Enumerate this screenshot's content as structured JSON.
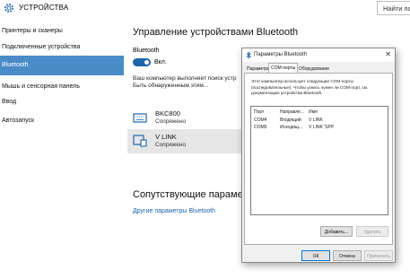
{
  "window": {
    "title": "УСТРОЙСТВА",
    "search_placeholder": "Найти пара"
  },
  "sidebar": {
    "items": [
      {
        "label": "Принтеры и сканеры",
        "selected": false
      },
      {
        "label": "Подключенные устройства",
        "selected": false
      },
      {
        "label": "Bluetooth",
        "selected": true
      },
      {
        "label": "Мышь и сенсорная панель",
        "selected": false
      },
      {
        "label": "Ввод",
        "selected": false
      },
      {
        "label": "Автозапуск",
        "selected": false
      }
    ]
  },
  "main": {
    "heading": "Управление устройствами Bluetooth",
    "bluetooth_label": "Bluetooth",
    "toggle_state": "Вкл.",
    "description_line1": "Ваш компьютер выполняет поиск устр",
    "description_line2": "Быть обнаруженным этим...",
    "devices": [
      {
        "name": "BKC800",
        "status": "Сопряжено",
        "icon": "keyboard-icon"
      },
      {
        "name": "V LINK",
        "status": "Сопряжено",
        "icon": "phone-device-icon"
      }
    ],
    "related_heading": "Сопутствующие параметр",
    "related_link": "Другие параметры Bluetooth"
  },
  "dialog": {
    "title": "Параметры Bluetooth",
    "close_glyph": "✕",
    "tabs": [
      "Параметры",
      "COM-порты",
      "Оборудование"
    ],
    "active_tab": 1,
    "info_text": "Этот компьютер использует следующие COM-порты (последовательные). Чтобы узнать нужен ли COM-порт, см. документацию устройства Bluetooth.",
    "columns": [
      "Порт",
      "Направле...",
      "Имя"
    ],
    "rows": [
      [
        "COM4",
        "Входящий",
        "V LINK"
      ],
      [
        "COM5",
        "Исходящ...",
        "V LINK 'SPP"
      ]
    ],
    "add_button": "Добавить...",
    "remove_button": "Удалить",
    "ok_button": "ОК",
    "cancel_button": "Отмена",
    "apply_button": "Применить"
  },
  "colors": {
    "accent": "#4a8cc8",
    "toggle_on": "#1e64ab",
    "link": "#1e64ab"
  }
}
